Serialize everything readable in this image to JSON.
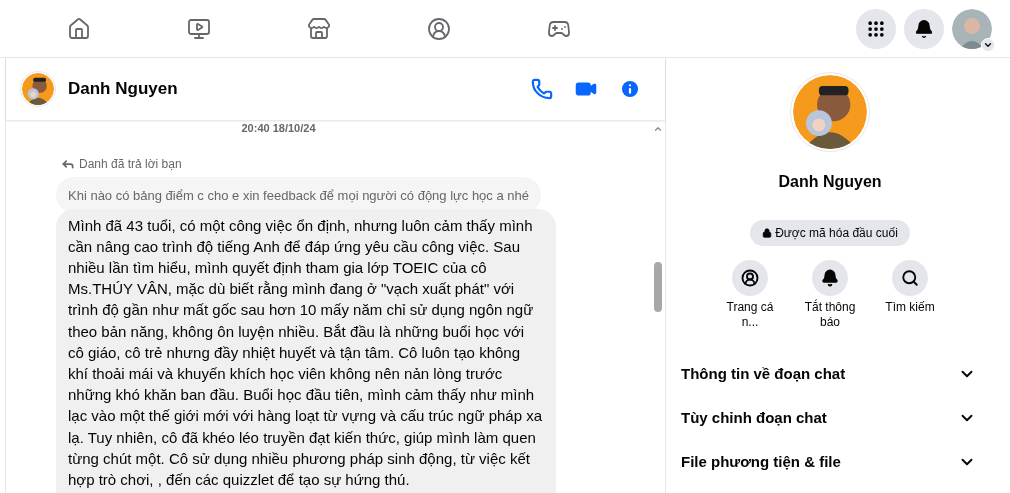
{
  "top_nav": {
    "tabs": [
      {
        "kind": "home",
        "selected": false
      },
      {
        "kind": "video",
        "selected": false
      },
      {
        "kind": "store",
        "selected": false
      },
      {
        "kind": "groups",
        "selected": false
      },
      {
        "kind": "gaming",
        "selected": false
      }
    ],
    "actions": [
      {
        "kind": "menu"
      },
      {
        "kind": "bell"
      }
    ]
  },
  "chat": {
    "contact_name": "Danh Nguyen",
    "header_actions": [
      {
        "kind": "phone"
      },
      {
        "kind": "video"
      },
      {
        "kind": "info"
      }
    ],
    "timestamp": "20:40 18/10/24",
    "reply_label": "Danh đã trả lời bạn",
    "quoted_message": "Khi nào có bảng điểm c cho e xin feedback để mọi người có động lực học a nhé",
    "message": "Mình đã 43 tuổi, có một công việc ổn định, nhưng luôn cảm thấy mình cần nâng cao trình độ tiếng Anh để đáp ứng yêu cầu công việc. Sau nhiều lần tìm hiểu, mình quyết định tham gia lớp TOEIC của cô Ms.THÚY VÂN, mặc dù biết rằng mình đang ở \"vạch xuất phát\" với trình độ gần như mất gốc sau hơn 10 mấy năm chỉ sử dụng ngôn ngữ theo bản năng, không ôn luyện nhiều. Bắt đầu là những buổi học với cô giáo, cô trẻ nhưng đầy nhiệt huyết và tận tâm. Cô luôn tạo không khí thoải mái và khuyến khích học viên không nên nản lòng trước những khó khăn ban đầu. Buổi học đầu tiên, mình cảm thấy như mình lạc vào một thế giới mới với hàng loạt từ vựng và cấu trúc ngữ pháp xa lạ. Tuy nhiên, cô đã khéo léo truyền đạt kiến thức, giúp mình làm quen từng chút một. Cô sử dụng nhiều phương pháp sinh động, từ việc kết hợp trò chơi, , đến các quizzlet để tạo sự hứng thú."
  },
  "info_panel": {
    "name": "Danh Nguyen",
    "encryption_badge": "Được mã hóa đầu cuối",
    "quick_actions": [
      {
        "kind": "profile",
        "label": "Trang cá n..."
      },
      {
        "kind": "bell",
        "label": "Tắt thông báo"
      },
      {
        "kind": "search",
        "label": "Tìm kiếm"
      }
    ],
    "sections": [
      {
        "label": "Thông tin về đoạn chat",
        "expanded": false
      },
      {
        "label": "Tùy chỉnh đoạn chat",
        "expanded": false
      },
      {
        "label": "File phương tiện & file",
        "expanded": false
      }
    ]
  }
}
